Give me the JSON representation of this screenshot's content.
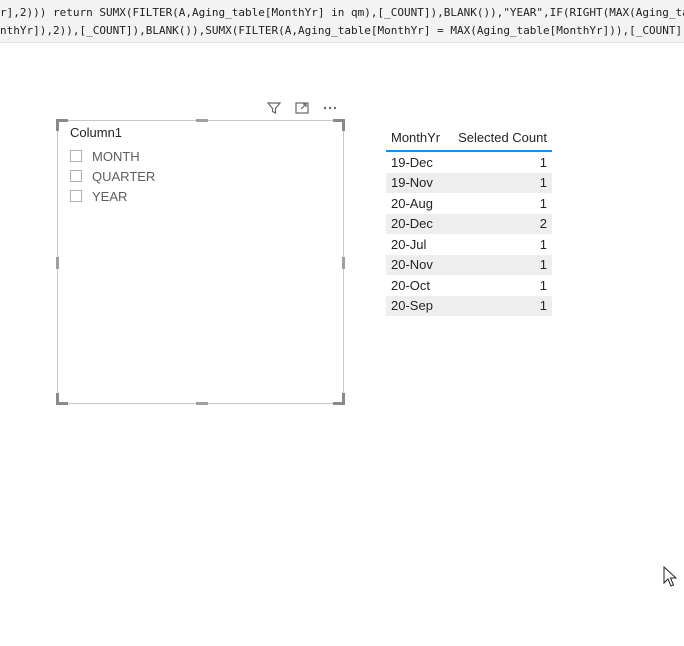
{
  "formula": {
    "line1": "r],2))) return SUMX(FILTER(A,Aging_table[MonthYr] in qm),[_COUNT]),BLANK()),\"YEAR\",IF(RIGHT(MAX(Aging_ta",
    "line2": "nthYr]),2)),[_COUNT]),BLANK()),SUMX(FILTER(A,Aging_table[MonthYr] = MAX(Aging_table[MonthYr])),[_COUNT]),"
  },
  "visual_header": {
    "filter_icon": "filter-icon",
    "focus_icon": "focus-mode-icon",
    "more_icon": "more-options-icon"
  },
  "slicer": {
    "title": "Column1",
    "items": [
      {
        "label": "MONTH",
        "checked": false
      },
      {
        "label": "QUARTER",
        "checked": false
      },
      {
        "label": "YEAR",
        "checked": false
      }
    ]
  },
  "table": {
    "headers": [
      "MonthYr",
      "Selected Count"
    ],
    "rows": [
      [
        "19-Dec",
        "1"
      ],
      [
        "19-Nov",
        "1"
      ],
      [
        "20-Aug",
        "1"
      ],
      [
        "20-Dec",
        "2"
      ],
      [
        "20-Jul",
        "1"
      ],
      [
        "20-Nov",
        "1"
      ],
      [
        "20-Oct",
        "1"
      ],
      [
        "20-Sep",
        "1"
      ]
    ]
  },
  "colors": {
    "header_underline": "#118dff",
    "alt_row": "#eeeeee"
  }
}
